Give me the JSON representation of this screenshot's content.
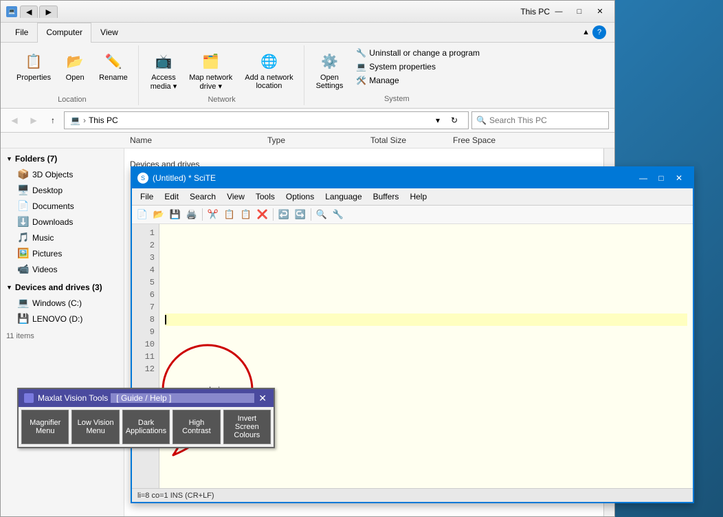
{
  "thispc": {
    "title": "This PC",
    "window_controls": {
      "minimize": "—",
      "maximize": "□",
      "close": "✕"
    },
    "ribbon": {
      "tabs": [
        "File",
        "Computer",
        "View"
      ],
      "active_tab": "Computer",
      "groups": {
        "location": {
          "label": "Location",
          "buttons": [
            {
              "label": "Properties",
              "icon": "📋"
            },
            {
              "label": "Open",
              "icon": "📂"
            },
            {
              "label": "Rename",
              "icon": "✏️"
            }
          ]
        },
        "network": {
          "label": "Network",
          "buttons": [
            {
              "label": "Access media",
              "icon": "📺"
            },
            {
              "label": "Map network drive",
              "icon": "🗂️"
            },
            {
              "label": "Add a network location",
              "icon": "🌐"
            }
          ]
        },
        "system": {
          "label": "System",
          "buttons": [
            {
              "label": "Open Settings",
              "icon": "⚙️"
            },
            {
              "label": "Uninstall or change a program",
              "icon": "🔧"
            },
            {
              "label": "System properties",
              "icon": "💻"
            },
            {
              "label": "Manage",
              "icon": "🔧"
            }
          ]
        }
      }
    },
    "address_bar": {
      "back_disabled": true,
      "forward_disabled": true,
      "path": "This PC",
      "search_placeholder": "Search This PC"
    },
    "columns": [
      "Name",
      "Type",
      "Total Size",
      "Free Space"
    ],
    "sidebar": {
      "folders_section": "Folders (7)",
      "folders": [
        {
          "name": "3D Objects",
          "icon": "📦"
        },
        {
          "name": "Desktop",
          "icon": "🖥️"
        },
        {
          "name": "Documents",
          "icon": "📄"
        },
        {
          "name": "Downloads",
          "icon": "⬇️"
        },
        {
          "name": "Music",
          "icon": "🎵"
        },
        {
          "name": "Pictures",
          "icon": "🖼️"
        },
        {
          "name": "Videos",
          "icon": "📹"
        }
      ],
      "devices_section": "Devices and drives (3)",
      "drives": [
        {
          "name": "Windows (C:)",
          "icon": "💻"
        },
        {
          "name": "LENOVO (D:)",
          "icon": "💾"
        }
      ],
      "status": "11 items"
    }
  },
  "scite": {
    "title": "(Untitled) * SciTE",
    "window_controls": {
      "minimize": "—",
      "maximize": "□",
      "close": "✕"
    },
    "menu_items": [
      "File",
      "Edit",
      "Search",
      "View",
      "Tools",
      "Options",
      "Language",
      "Buffers",
      "Help"
    ],
    "toolbar_icons": [
      "📄",
      "📂",
      "💾",
      "🖨️",
      "✂️",
      "📋",
      "📋",
      "❌",
      "↩️",
      "↪️",
      "🔍",
      "🔧"
    ],
    "line_numbers": [
      1,
      2,
      3,
      4,
      5,
      6,
      7,
      8,
      9,
      10,
      11,
      12
    ],
    "editor_content": "",
    "cursor_line": 8,
    "status_bar": "li=8 co=1 INS (CR+LF)"
  },
  "annotation": {
    "text": "normal view"
  },
  "maxlat": {
    "title": "Maxlat Vision Tools",
    "guide_text": "[ Guide / Help ]",
    "close": "✕",
    "buttons": [
      {
        "label": "Magnifier\nMenu"
      },
      {
        "label": "Low Vision\nMenu"
      },
      {
        "label": "Dark\nApplications"
      },
      {
        "label": "High\nContrast"
      },
      {
        "label": "Invert Screen\nColours"
      }
    ]
  }
}
